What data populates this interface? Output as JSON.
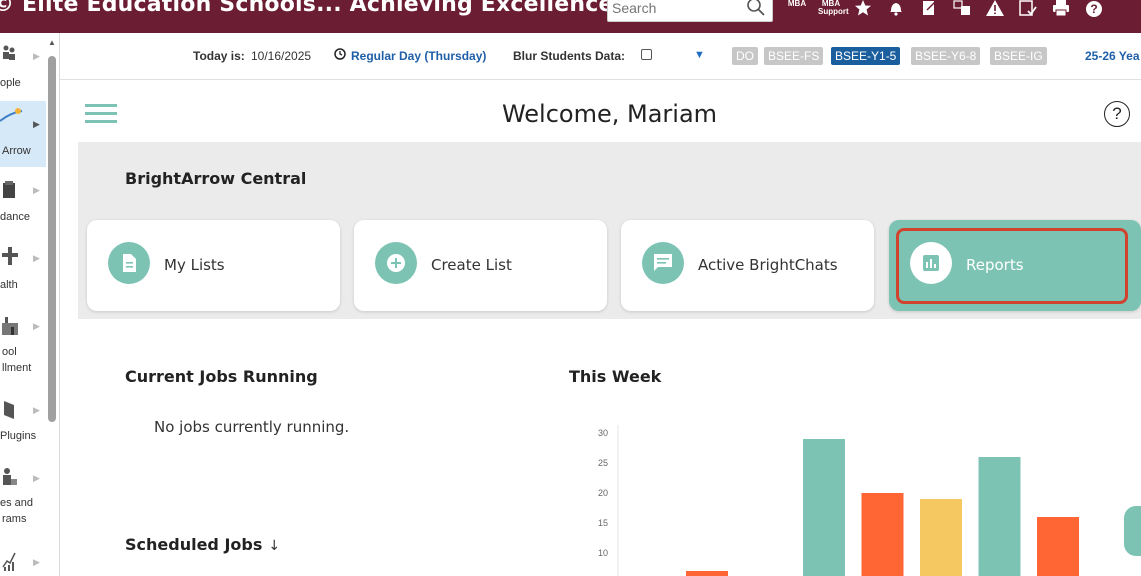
{
  "topbar": {
    "title": "© Elite Education Schools... Achieving Excellence in Life!",
    "search_placeholder": "Search",
    "mba_label": "MBA",
    "mba_support_line1": "MBA",
    "mba_support_line2": "Support",
    "icons": [
      "star-icon",
      "bell-icon",
      "note-icon",
      "translate-icon",
      "warning-icon",
      "checklist-icon",
      "print-icon",
      "help-icon"
    ]
  },
  "sidebar": {
    "items": [
      {
        "label": "ople",
        "icon": "people-icon"
      },
      {
        "label": "Arrow",
        "icon": "brightarrow-icon"
      },
      {
        "label": "dance",
        "icon": "attendance-icon"
      },
      {
        "label": "alth",
        "icon": "health-icon"
      },
      {
        "label_line1": "ool",
        "label_line2": "llment",
        "icon": "enrollment-icon"
      },
      {
        "label": "Plugins",
        "icon": "plugins-icon"
      },
      {
        "label_line1": "es and",
        "label_line2": "rams",
        "icon": "programs-icon"
      },
      {
        "label": "",
        "icon": "reports-chart-icon"
      }
    ]
  },
  "infobar": {
    "today_label": "Today is:",
    "today_value": "10/16/2025",
    "day_type": "Regular Day (Thursday)",
    "blur_label": "Blur Students Data:",
    "badges": [
      "DO",
      "BSEE-FS",
      "BSEE-Y1-5",
      "BSEE-Y6-8",
      "BSEE-IG"
    ],
    "active_badge": "BSEE-Y1-5",
    "year": "25-26 Yea"
  },
  "header": {
    "welcome": "Welcome, Mariam",
    "help": "?"
  },
  "central": {
    "title": "BrightArrow Central",
    "cards": [
      {
        "label": "My Lists",
        "icon": "document-icon"
      },
      {
        "label": "Create List",
        "icon": "plus-circle-icon"
      },
      {
        "label": "Active BrightChats",
        "icon": "chat-icon"
      },
      {
        "label": "Reports",
        "icon": "bar-chart-icon"
      }
    ]
  },
  "jobs": {
    "current_title": "Current Jobs Running",
    "no_jobs": "No jobs currently running.",
    "scheduled_title": "Scheduled Jobs",
    "sort_arrow": "↓"
  },
  "week": {
    "title": "This Week"
  },
  "chart_data": {
    "type": "bar",
    "categories": [
      "",
      "",
      "",
      "",
      "",
      "",
      ""
    ],
    "values": [
      7,
      0,
      29,
      20,
      19,
      26,
      16
    ],
    "colors": [
      "#ff6633",
      "#7cc3b3",
      "#7cc3b3",
      "#ff6633",
      "#f5c862",
      "#7cc3b3",
      "#ff6633"
    ],
    "yticks": [
      10,
      15,
      20,
      25,
      30
    ],
    "ylim": [
      5,
      32
    ],
    "title": "",
    "xlabel": "",
    "ylabel": ""
  }
}
